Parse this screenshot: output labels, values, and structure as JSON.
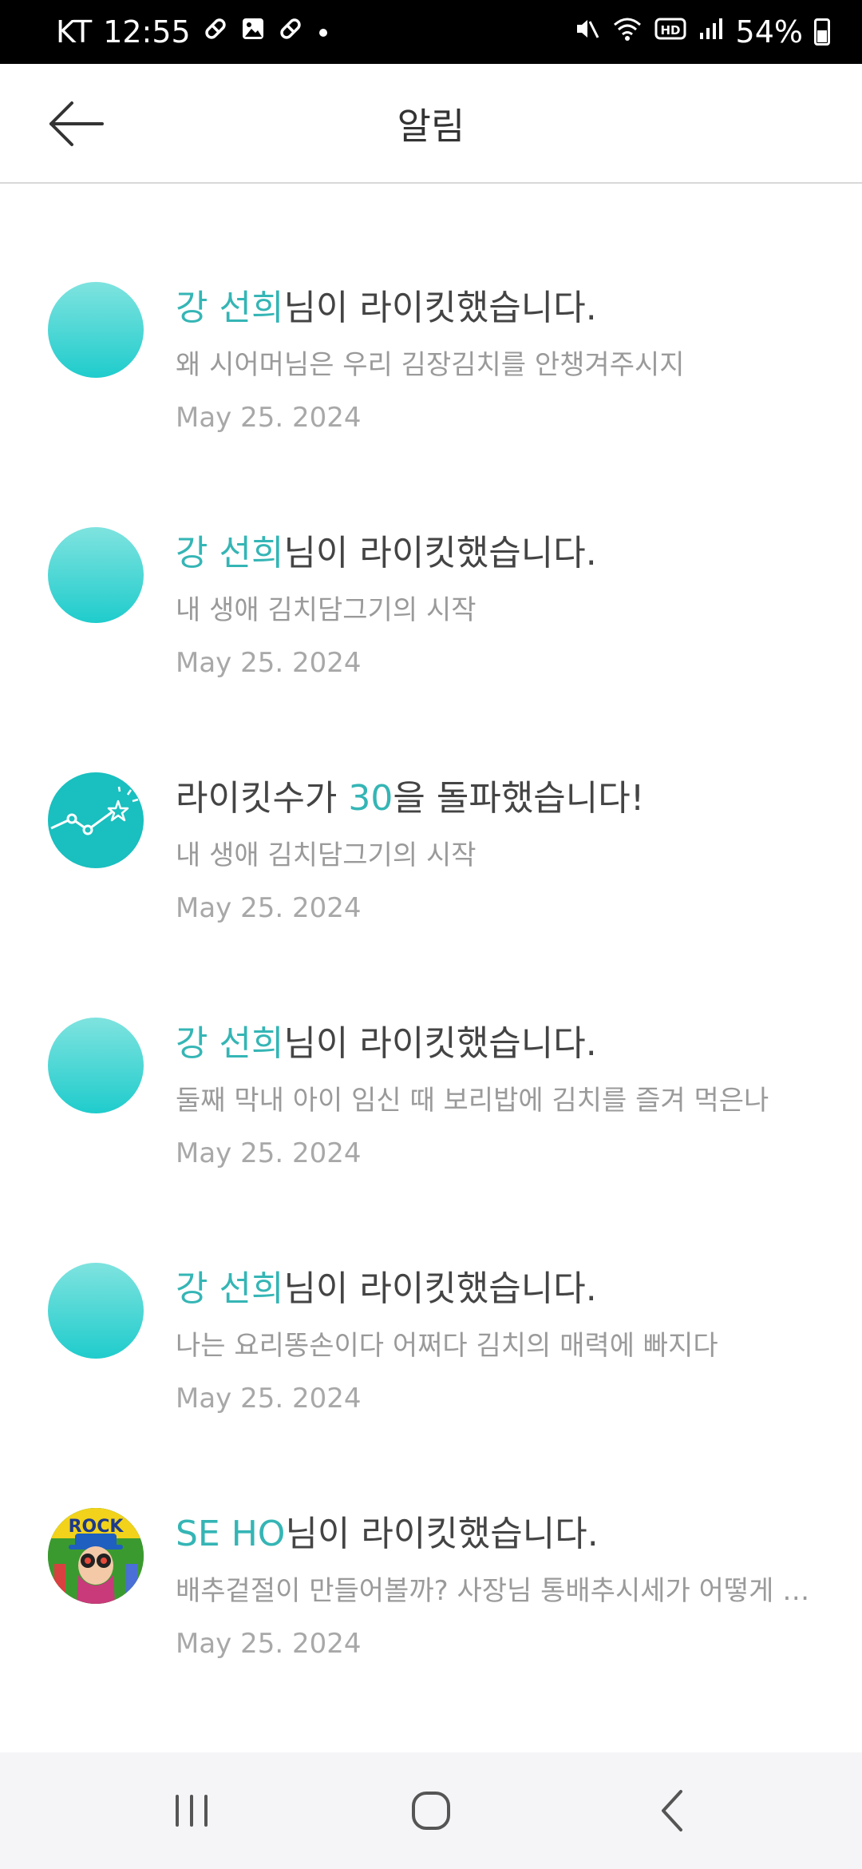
{
  "status_bar": {
    "carrier": "KT",
    "time": "12:55",
    "battery": "54%",
    "battery_level": 0.54,
    "icons_left": [
      "pill-icon",
      "image-icon",
      "pill-icon",
      "dot-icon"
    ],
    "icons_right": [
      "mute-icon",
      "wifi-icon",
      "hd-icon",
      "signal-icon",
      "battery-icon"
    ]
  },
  "header": {
    "title": "알림",
    "back_icon": "arrow-left-icon"
  },
  "notifications": [
    {
      "avatar": "plain",
      "name": "강 선희",
      "suffix": "님이 라이킷했습니다.",
      "subtitle": "왜 시어머님은 우리 김장김치를 안챙겨주시지",
      "date": "May 25. 2024"
    },
    {
      "avatar": "plain",
      "name": "강 선희",
      "suffix": "님이 라이킷했습니다.",
      "subtitle": "내 생애 김치담그기의 시작",
      "date": "May 25. 2024"
    },
    {
      "avatar": "milestone",
      "prefix": "라이킷수가 ",
      "count": "30",
      "suffix": "을 돌파했습니다!",
      "subtitle": "내 생애 김치담그기의 시작",
      "date": "May 25. 2024"
    },
    {
      "avatar": "plain",
      "name": "강 선희",
      "suffix": "님이 라이킷했습니다.",
      "subtitle": "둘째 막내 아이 임신 때 보리밥에 김치를 즐겨 먹은나",
      "date": "May 25. 2024"
    },
    {
      "avatar": "plain",
      "name": "강 선희",
      "suffix": "님이 라이킷했습니다.",
      "subtitle": "나는 요리똥손이다 어쩌다 김치의 매력에 빠지다",
      "date": "May 25. 2024"
    },
    {
      "avatar": "photo",
      "avatar_text": "ROCK",
      "name": "SE HO",
      "suffix": "님이 라이킷했습니다.",
      "subtitle": "배추겉절이 만들어볼까?  사장님 통배추시세가 어떻게 …",
      "date": "May 25. 2024"
    }
  ],
  "colors": {
    "accent": "#35b5b5",
    "avatar_top": "#7fe3df",
    "avatar_bottom": "#1fcccc",
    "milestone_bg": "#1abfbf"
  },
  "nav_bar": {
    "recents_icon": "recents-icon",
    "home_icon": "home-icon",
    "back_icon": "chevron-left-icon"
  }
}
